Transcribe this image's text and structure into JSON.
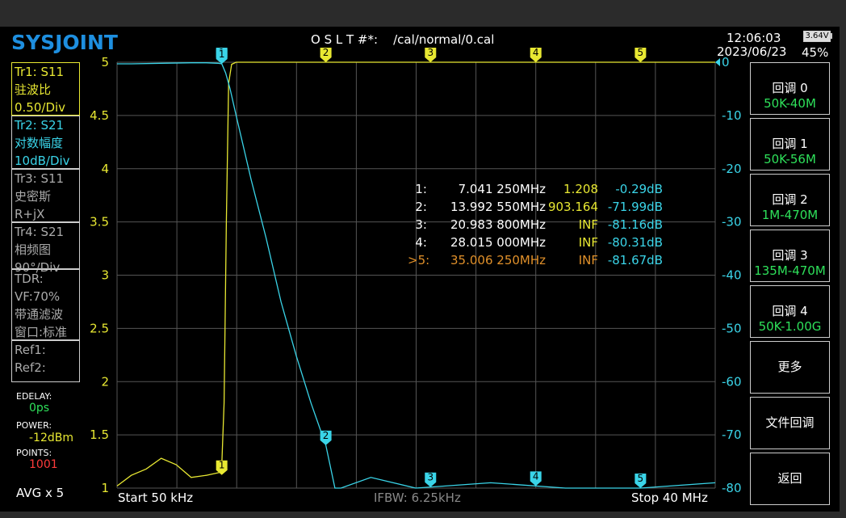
{
  "header": {
    "logo": "SYSJOINT",
    "cal_status": "O S L T #*:    /cal/normal/0.cal",
    "time": "12:06:03",
    "date": "2023/06/23",
    "battery_voltage": "3.64V",
    "battery_percent": "45%"
  },
  "traces": [
    {
      "line1": "Tr1:   S11",
      "line2": "驻波比",
      "line3": "0.50/Div",
      "color": "#e8e832",
      "active": true
    },
    {
      "line1": "Tr2:   S21",
      "line2": "对数幅度",
      "line3": "10dB/Div",
      "color": "#3ad4e8",
      "active": true
    },
    {
      "line1": "Tr3:   S11",
      "line2": "史密斯",
      "line3": "R+jX",
      "color": "#aaaaaa",
      "active": false
    },
    {
      "line1": "Tr4:   S21",
      "line2": "相频图",
      "line3": "90°/Div",
      "color": "#aaaaaa",
      "active": false
    }
  ],
  "tdr": {
    "line1": "TDR:",
    "line2": "VF:70%",
    "line3": "带通滤波",
    "line4": "窗口:标准"
  },
  "ref": {
    "line1": "Ref1:",
    "line2": "Ref2:"
  },
  "settings": {
    "edelay_label": "EDELAY:",
    "edelay_value": "0ps",
    "power_label": "POWER:",
    "power_value": "-12dBm",
    "points_label": "POINTS:",
    "points_value": "1001",
    "avg": "AVG x 5"
  },
  "menu": [
    {
      "label": "回调 0",
      "sub": "50K-40M"
    },
    {
      "label": "回调 1",
      "sub": "50K-56M"
    },
    {
      "label": "回调 2",
      "sub": "1M-470M"
    },
    {
      "label": "回调 3",
      "sub": "135M-470M"
    },
    {
      "label": "回调 4",
      "sub": "50K-1.00G"
    },
    {
      "label": "更多",
      "sub": ""
    },
    {
      "label": "文件回调",
      "sub": ""
    },
    {
      "label": "返回",
      "sub": ""
    }
  ],
  "markers": [
    {
      "id": "1:",
      "freq": "7.041 250MHz",
      "swr": "1.208",
      "db": "-0.29dB",
      "active": false
    },
    {
      "id": "2:",
      "freq": "13.992 550MHz",
      "swr": "903.164",
      "db": "-71.99dB",
      "active": false
    },
    {
      "id": "3:",
      "freq": "20.983 800MHz",
      "swr": "INF",
      "db": "-81.16dB",
      "active": false
    },
    {
      "id": "4:",
      "freq": "28.015 000MHz",
      "swr": "INF",
      "db": "-80.31dB",
      "active": false
    },
    {
      "id": ">5:",
      "freq": "35.006 250MHz",
      "swr": "INF",
      "db": "-81.67dB",
      "active": true
    }
  ],
  "footer": {
    "start": "Start   50 kHz",
    "ifbw": "IFBW: 6.25kHz",
    "stop": "Stop   40 MHz"
  },
  "colors": {
    "s11": "#e8e832",
    "s21": "#3ad4e8",
    "grid": "#555555",
    "active_marker": "#e0902a",
    "menu_sub": "#2ee05a"
  },
  "chart_data": {
    "type": "line",
    "x_range_mhz": [
      0.05,
      40
    ],
    "left_axis": {
      "ticks": [
        "5",
        "4.5",
        "4",
        "3.5",
        "3",
        "2.5",
        "2",
        "1.5",
        "1"
      ],
      "range": [
        1,
        5
      ]
    },
    "right_axis": {
      "ticks": [
        "0",
        "-10",
        "-20",
        "-30",
        "-40",
        "-50",
        "-60",
        "-70",
        "-80"
      ],
      "range": [
        -80,
        0
      ]
    },
    "series": [
      {
        "trace": "S11",
        "axis": "left",
        "x": [
          0.05,
          1,
          2,
          3,
          4,
          5,
          6,
          7,
          7.04,
          7.2,
          7.35,
          7.5,
          7.7,
          8,
          9,
          10,
          12,
          15,
          20,
          25,
          30,
          35,
          40
        ],
        "y": [
          1.02,
          1.12,
          1.18,
          1.28,
          1.22,
          1.1,
          1.12,
          1.15,
          1.21,
          1.8,
          3.5,
          4.8,
          4.98,
          5,
          5,
          5,
          5,
          5,
          5,
          5,
          5,
          5,
          5
        ]
      },
      {
        "trace": "S21",
        "axis": "right",
        "x": [
          0.05,
          1,
          3,
          5,
          6,
          6.8,
          7.04,
          7.3,
          7.6,
          8,
          9,
          10,
          11,
          12,
          13,
          14,
          14.3,
          14.6,
          15,
          17,
          20,
          25,
          30,
          35,
          40
        ],
        "y": [
          -0.3,
          -0.3,
          -0.2,
          -0.1,
          -0.1,
          -0.2,
          -0.29,
          -2,
          -5,
          -10,
          -22,
          -33,
          -45,
          -55,
          -64,
          -72,
          -76,
          -80,
          -80,
          -78,
          -80,
          -79,
          -80,
          -81,
          -79
        ]
      }
    ],
    "marker_x_mhz": [
      7.04125,
      13.99255,
      20.9838,
      28.015,
      35.00625
    ]
  }
}
